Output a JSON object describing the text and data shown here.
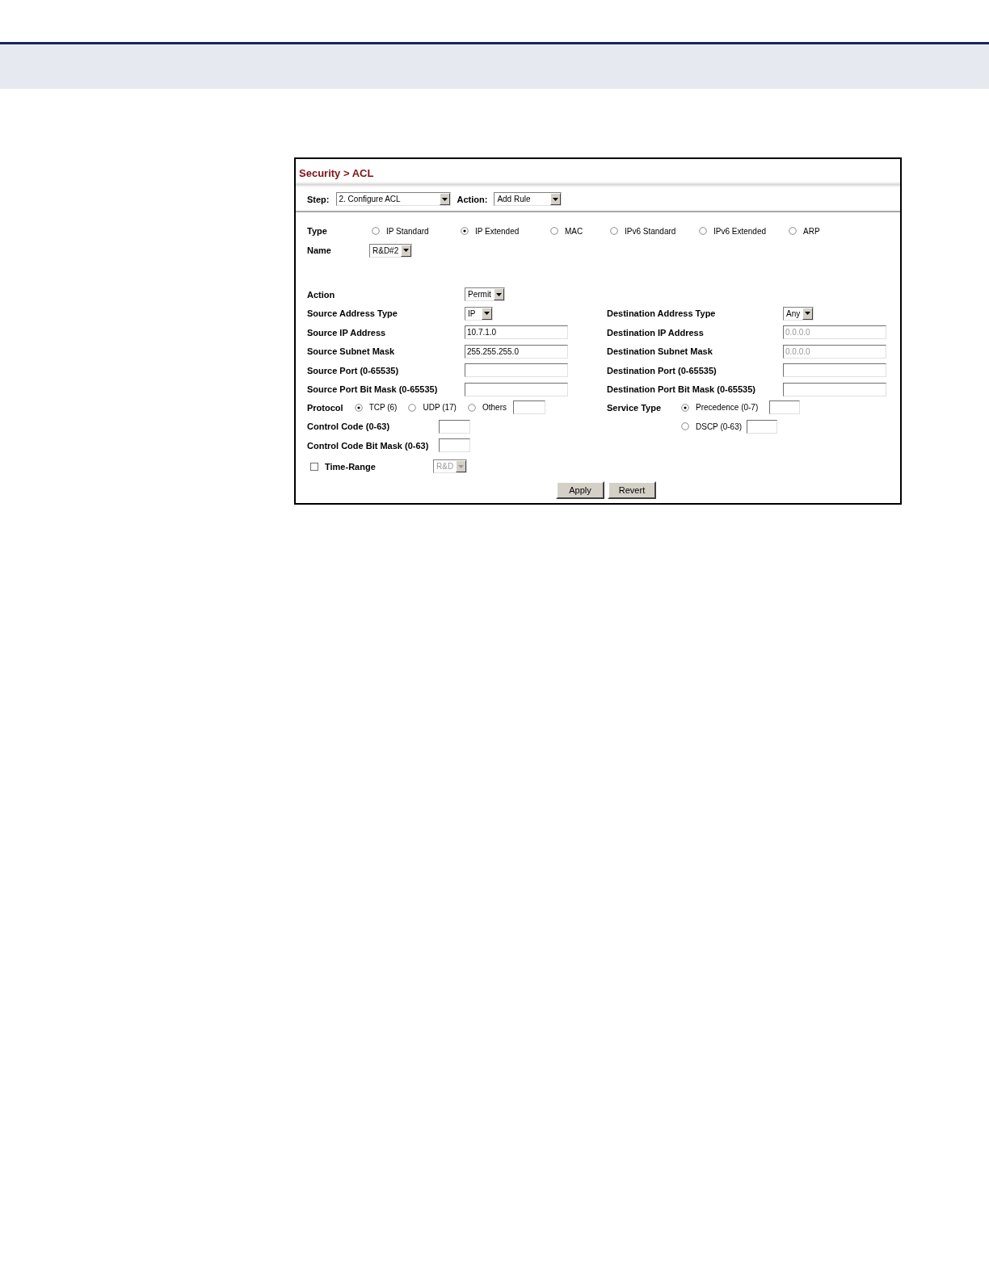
{
  "title": "Security > ACL",
  "toolbar": {
    "step": {
      "label": "Step:",
      "value": "2. Configure ACL"
    },
    "action": {
      "label": "Action:",
      "value": "Add Rule"
    }
  },
  "type": {
    "label": "Type",
    "options": [
      {
        "label": "IP Standard",
        "selected": false
      },
      {
        "label": "IP Extended",
        "selected": true
      },
      {
        "label": "MAC",
        "selected": false
      },
      {
        "label": "IPv6 Standard",
        "selected": false
      },
      {
        "label": "IPv6 Extended",
        "selected": false
      },
      {
        "label": "ARP",
        "selected": false
      }
    ]
  },
  "name": {
    "label": "Name",
    "value": "R&D#2"
  },
  "action": {
    "label": "Action",
    "value": "Permit"
  },
  "source_rows": [
    {
      "label": "Source Address Type",
      "kind": "select",
      "value": "IP"
    },
    {
      "label": "Source IP Address",
      "kind": "input",
      "value": "10.7.1.0",
      "disabled": false
    },
    {
      "label": "Source Subnet Mask",
      "kind": "input",
      "value": "255.255.255.0",
      "disabled": false
    },
    {
      "label": "Source Port (0-65535)",
      "kind": "input"
    },
    {
      "label": "Source Port Bit Mask (0-65535)",
      "kind": "input"
    }
  ],
  "destination_rows": [
    {
      "label": "Destination Address Type",
      "kind": "select",
      "value": "Any"
    },
    {
      "label": "Destination IP Address",
      "kind": "input",
      "value": "0.0.0.0",
      "disabled": true
    },
    {
      "label": "Destination Subnet Mask",
      "kind": "input",
      "value": "0.0.0.0",
      "disabled": true
    },
    {
      "label": "Destination Port (0-65535)",
      "kind": "input"
    },
    {
      "label": "Destination Port Bit Mask (0-65535)",
      "kind": "input"
    }
  ],
  "protocol": {
    "label": "Protocol",
    "options": [
      {
        "label": "TCP (6)",
        "selected": true
      },
      {
        "label": "UDP (17)",
        "selected": false
      },
      {
        "label": "Others",
        "selected": false
      }
    ]
  },
  "service_type": {
    "label": "Service Type",
    "options": [
      {
        "label": "Precedence (0-7)",
        "selected": true
      },
      {
        "label": "DSCP (0-63)",
        "selected": false
      }
    ]
  },
  "control_code": {
    "label": "Control Code (0-63)"
  },
  "control_code_bit_mask": {
    "label": "Control Code Bit Mask (0-63)"
  },
  "time_range": {
    "label": "Time-Range",
    "checked": false,
    "value": "R&D",
    "disabled": true
  },
  "buttons": [
    "Apply",
    "Revert"
  ]
}
